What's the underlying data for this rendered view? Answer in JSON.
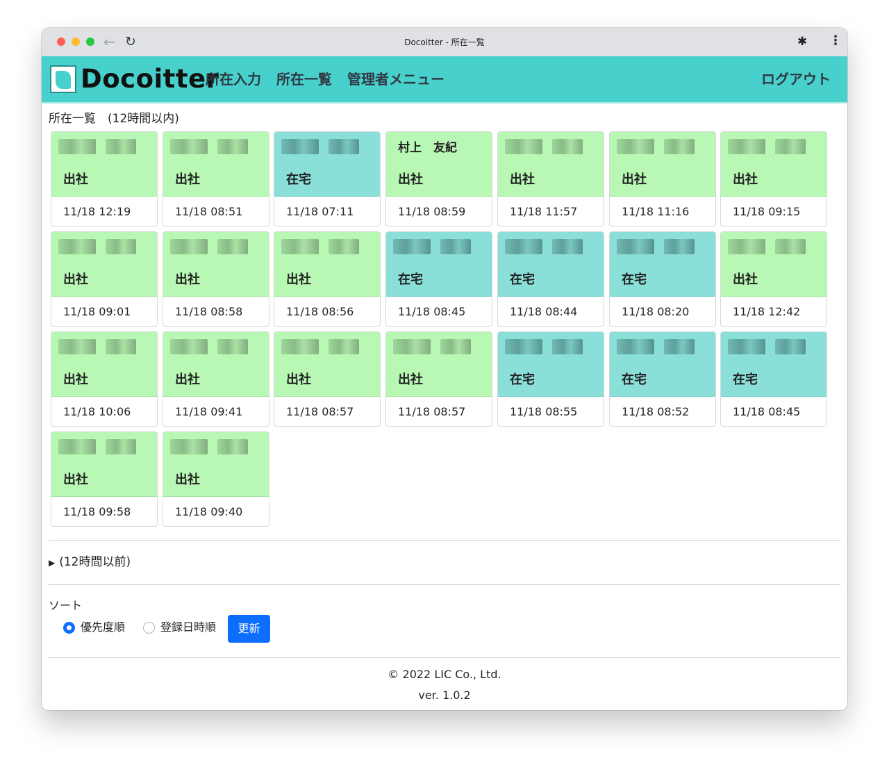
{
  "browser": {
    "window_title": "Docoitter - 所在一覧",
    "back_glyph": "←",
    "reload_glyph": "↻",
    "extensions_glyph": "✱",
    "menu_glyph": "⋮"
  },
  "header": {
    "brand": "Docoitter",
    "menu": [
      "所在入力",
      "所在一覧",
      "管理者メニュー"
    ],
    "logout": "ログアウト"
  },
  "presence": {
    "title": "所在一覧　(12時間以内)",
    "cards": [
      {
        "name": "",
        "status": "出社",
        "time": "11/18 12:19",
        "type": "office"
      },
      {
        "name": "",
        "status": "出社",
        "time": "11/18 08:51",
        "type": "office"
      },
      {
        "name": "",
        "status": "在宅",
        "time": "11/18 07:11",
        "type": "home"
      },
      {
        "name": "村上　友紀",
        "status": "出社",
        "time": "11/18 08:59",
        "type": "office"
      },
      {
        "name": "",
        "status": "出社",
        "time": "11/18 11:57",
        "type": "office"
      },
      {
        "name": "",
        "status": "出社",
        "time": "11/18 11:16",
        "type": "office"
      },
      {
        "name": "",
        "status": "出社",
        "time": "11/18 09:15",
        "type": "office"
      },
      {
        "name": "",
        "status": "出社",
        "time": "11/18 09:01",
        "type": "office"
      },
      {
        "name": "",
        "status": "出社",
        "time": "11/18 08:58",
        "type": "office"
      },
      {
        "name": "",
        "status": "出社",
        "time": "11/18 08:56",
        "type": "office"
      },
      {
        "name": "",
        "status": "在宅",
        "time": "11/18 08:45",
        "type": "home"
      },
      {
        "name": "",
        "status": "在宅",
        "time": "11/18 08:44",
        "type": "home"
      },
      {
        "name": "",
        "status": "在宅",
        "time": "11/18 08:20",
        "type": "home"
      },
      {
        "name": "",
        "status": "出社",
        "time": "11/18 12:42",
        "type": "office"
      },
      {
        "name": "",
        "status": "出社",
        "time": "11/18 10:06",
        "type": "office"
      },
      {
        "name": "",
        "status": "出社",
        "time": "11/18 09:41",
        "type": "office"
      },
      {
        "name": "",
        "status": "出社",
        "time": "11/18 08:57",
        "type": "office"
      },
      {
        "name": "",
        "status": "出社",
        "time": "11/18 08:57",
        "type": "office"
      },
      {
        "name": "",
        "status": "在宅",
        "time": "11/18 08:55",
        "type": "home"
      },
      {
        "name": "",
        "status": "在宅",
        "time": "11/18 08:52",
        "type": "home"
      },
      {
        "name": "",
        "status": "在宅",
        "time": "11/18 08:45",
        "type": "home"
      },
      {
        "name": "",
        "status": "出社",
        "time": "11/18 09:58",
        "type": "office"
      },
      {
        "name": "",
        "status": "出社",
        "time": "11/18 09:40",
        "type": "office"
      }
    ]
  },
  "older": {
    "toggle_glyph": "▶",
    "label": "(12時間以前)"
  },
  "sort": {
    "label": "ソート",
    "options": [
      "優先度順",
      "登録日時順"
    ],
    "selected": "優先度順",
    "update_button": "更新"
  },
  "footer": {
    "copyright": "© 2022 LIC Co., Ltd.",
    "version": "ver. 1.0.2"
  },
  "colors": {
    "header_bg": "#48d1cc",
    "office_bg": "#b9f8b4",
    "home_bg": "#8adfd9",
    "primary": "#0d6efd"
  }
}
